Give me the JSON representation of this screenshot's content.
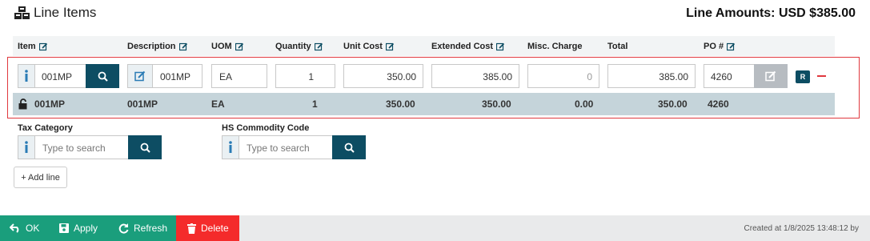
{
  "header": {
    "title": "Line Items",
    "amount": "Line Amounts: USD $385.00"
  },
  "columns": [
    {
      "label": "Item"
    },
    {
      "label": "Description"
    },
    {
      "label": "UOM"
    },
    {
      "label": "Quantity"
    },
    {
      "label": "Unit Cost"
    },
    {
      "label": "Extended Cost"
    },
    {
      "label": "Misc. Charge"
    },
    {
      "label": "Total"
    },
    {
      "label": "PO #"
    }
  ],
  "edit_row": {
    "item": "001MP",
    "description": "001MP",
    "uom": "EA",
    "quantity": "1",
    "unit_cost": "350.00",
    "extended_cost": "385.00",
    "misc_charge": "0",
    "total": "385.00",
    "po": "4260",
    "badge": "R"
  },
  "summary_row": {
    "item": "001MP",
    "description": "001MP",
    "uom": "EA",
    "quantity": "1",
    "unit_cost": "350.00",
    "extended_cost": "350.00",
    "misc_charge": "0.00",
    "total": "350.00",
    "po": "4260"
  },
  "tax": {
    "label": "Tax Category",
    "placeholder": "Type to search"
  },
  "hs": {
    "label": "HS Commodity Code",
    "placeholder": "Type to search"
  },
  "add_line": "+ Add line",
  "footer": {
    "ok": "OK",
    "apply": "Apply",
    "refresh": "Refresh",
    "delete": "Delete",
    "created": "Created at 1/8/2025 13:48:12 by"
  },
  "colors": {
    "primary": "#0d4d63",
    "accent": "#1a9e7c",
    "danger": "#f42b2b",
    "highlight": "#e0383e"
  },
  "icons": [
    "cubes-icon",
    "edit-icon",
    "info-icon",
    "search-icon",
    "unlock-icon",
    "undo-icon",
    "save-icon",
    "refresh-icon",
    "trash-icon"
  ]
}
